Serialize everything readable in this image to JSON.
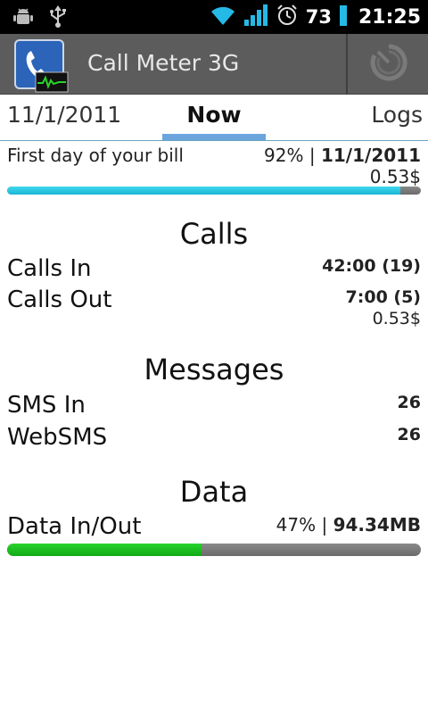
{
  "status_bar": {
    "icons": [
      "android-debug-icon",
      "usb-icon",
      "wifi-icon",
      "signal-icon",
      "alarm-icon",
      "battery-icon"
    ],
    "battery": "73",
    "time": "21:25"
  },
  "title_bar": {
    "title": "Call Meter 3G"
  },
  "tabs": {
    "left": "11/1/2011",
    "current": "Now",
    "right": "Logs"
  },
  "bill": {
    "label": "First day of your bill",
    "percent": "92%",
    "separator": "|",
    "date": "11/1/2011",
    "cost": "0.53$",
    "progress": 0.95,
    "colors": {
      "fill": "#1bb6d3"
    }
  },
  "calls": {
    "title": "Calls",
    "in_label": "Calls In",
    "in_value": "42:00 (19)",
    "out_label": "Calls Out",
    "out_value": "7:00 (5)",
    "out_cost": "0.53$"
  },
  "messages": {
    "title": "Messages",
    "sms_label": "SMS In",
    "sms_value": "26",
    "web_label": "WebSMS",
    "web_value": "26"
  },
  "data": {
    "title": "Data",
    "label": "Data In/Out",
    "percent": "47%",
    "separator": "|",
    "amount": "94.34MB",
    "progress": 0.47,
    "colors": {
      "fill": "#12a915"
    }
  }
}
